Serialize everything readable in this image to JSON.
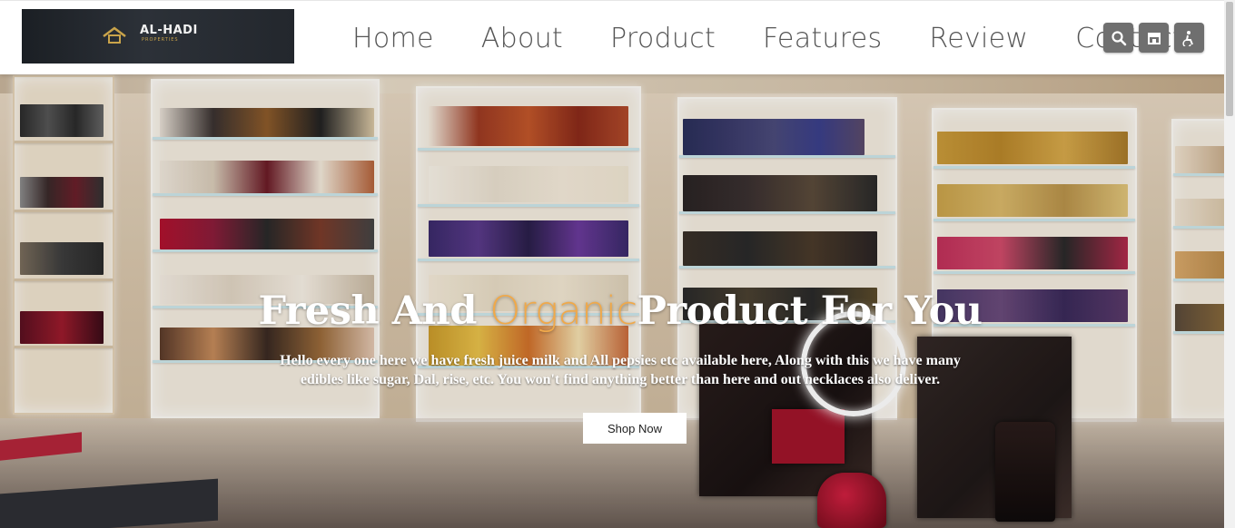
{
  "logo": {
    "text": "AL-HADI",
    "subtext": "PROPERTIES"
  },
  "nav": {
    "items": [
      {
        "label": "Home"
      },
      {
        "label": "About"
      },
      {
        "label": "Product"
      },
      {
        "label": "Features"
      },
      {
        "label": "Review"
      },
      {
        "label": "Contact"
      }
    ]
  },
  "header_icons": [
    "search-icon",
    "store-icon",
    "accessibility-icon"
  ],
  "hero": {
    "title_before": "Fresh And ",
    "title_accent": "Organic",
    "title_after": "Product For You",
    "description": "Hello every one here we have fresh juice milk and All pepsies etc available here, Along with this we have many edibles like sugar, Dal, rise, etc. You won't find anything better than here and out necklaces also deliver.",
    "button_label": "Shop Now"
  },
  "colors": {
    "accent": "#f0a94a",
    "icon_button_bg": "#6f6f6f",
    "nav_text": "#555555"
  }
}
